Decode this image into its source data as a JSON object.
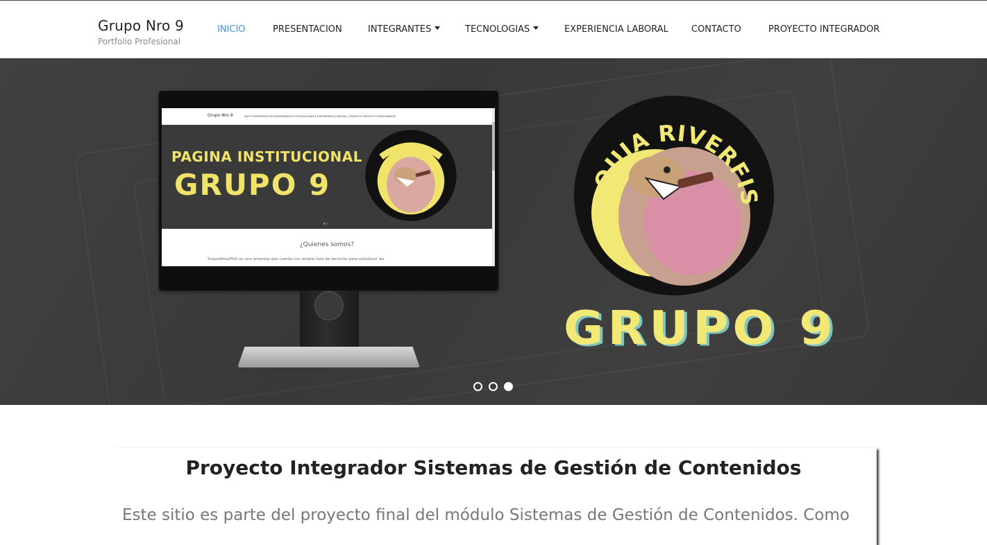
{
  "brand": {
    "title": "Grupo Nro 9",
    "subtitle": "Portfolio Profesional"
  },
  "nav": {
    "items": [
      {
        "label": "INICIO",
        "active": true
      },
      {
        "label": "PRESENTACION"
      },
      {
        "label": "INTEGRANTES",
        "dropdown": true
      },
      {
        "label": "TECNOLOGIAS",
        "dropdown": true
      },
      {
        "label": "EXPERIENCIA LABORAL"
      },
      {
        "label": "CONTACTO"
      },
      {
        "label": "PROYECTO INTEGRADOR"
      }
    ]
  },
  "hero": {
    "mini_site": {
      "brand": "Grupo Nro 9",
      "links": "INICIO   PRESENTACION   INTEGRANTES ▾   TECNOLOGIAS ▾   EXPERIENCIA LABORAL   CONTACTO   PROYECTO INTEGRADOR",
      "title_line1": "PAGINA INSTITUCIONAL",
      "title_line2": "GRUPO 9",
      "question": "¿Quienes somos?",
      "paragraph": "SuquiaRiverFish es una empresa que cuenta con amplia lista de servicios para satisfacer las"
    },
    "logo_text": "SUQUIA RIVERFISH",
    "big_title": "GRUPO 9",
    "slides_count": 3,
    "active_slide": 3
  },
  "colors": {
    "nav_active": "#4a8fd6",
    "logo_yellow": "#f2e875",
    "hero_bg": "#3a3939"
  },
  "content": {
    "title": "Proyecto Integrador Sistemas de Gestión de Contenidos",
    "text": "Este sitio es parte del proyecto final del módulo Sistemas de Gestión de Contenidos. Como"
  }
}
